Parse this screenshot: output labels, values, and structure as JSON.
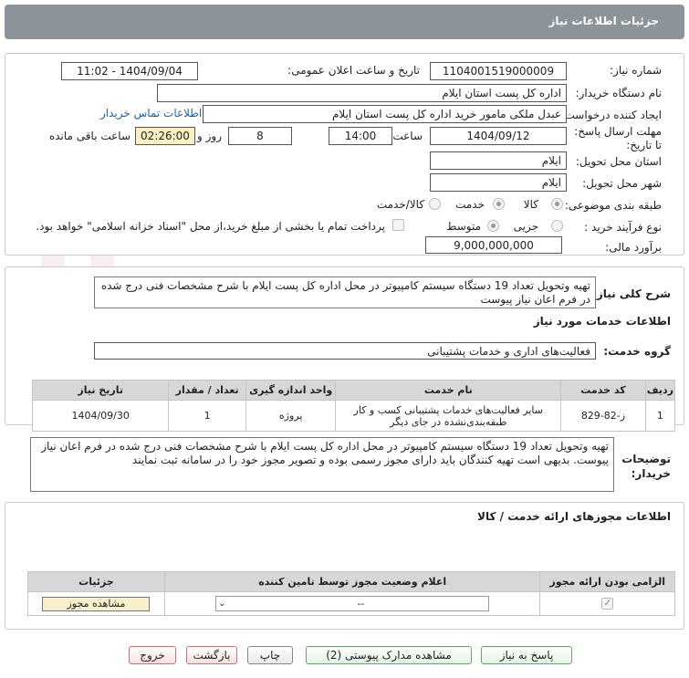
{
  "header": {
    "title": "جزئیات اطلاعات نیاز"
  },
  "form": {
    "need_number_label": "شماره نیاز:",
    "need_number": "1104001519000009",
    "announce_label": "تاریخ و ساعت اعلان عمومی:",
    "announce_value": "1404/09/04 - 11:02",
    "buyer_org_label": "نام دستگاه خریدار:",
    "buyer_org": "اداره کل پست استان ایلام",
    "creator_label": "ایجاد کننده درخواست:",
    "creator": "عبدل ملکی مامور خرید  اداره کل پست استان ایلام",
    "contact_link": "اطلاعات تماس خریدار",
    "deadline_label": "مهلت ارسال پاسخ: تا تاریخ:",
    "deadline_date": "1404/09/12",
    "time_label": "ساعت",
    "deadline_time": "14:00",
    "days": "8",
    "days_label": "روز و",
    "remaining": "02:26:00",
    "remaining_label": "ساعت باقی مانده",
    "province_label": "استان محل تحویل:",
    "province": "ایلام",
    "city_label": "شهر محل تحویل:",
    "city": "ایلام",
    "category_label": "طبقه بندی موضوعی:",
    "category_options": [
      "کالا",
      "خدمت",
      "کالا/خدمت"
    ],
    "process_label": "نوع فرآیند خرید :",
    "process_options": [
      "جزیی",
      "متوسط"
    ],
    "payment_note": "پرداخت تمام یا بخشی از مبلغ خرید،از محل \"اسناد خزانه اسلامی\" خواهد بود.",
    "budget_label": "برآورد مالی:",
    "budget": "9,000,000,000"
  },
  "summary": {
    "label": "شرح کلی نیاز:",
    "text": "تهیه وتحویل تعداد 19 دستگاه سیستم کامپیوتر  در محل  اداره کل پست ایلام با شرح مشخصات فنی درج شده در فرم اعان نیاز پیوست",
    "services_title": "اطلاعات خدمات مورد نیاز",
    "group_label": "گروه خدمت:",
    "group_value": "فعالیت‌های اداری و خدمات پشتیبانی"
  },
  "services_table": {
    "headers": [
      "ردیف",
      "کد خدمت",
      "نام خدمت",
      "واحد اندازه گیری",
      "تعداد / مقدار",
      "تاریخ نیاز"
    ],
    "rows": [
      [
        "1",
        "ز-82-829",
        "سایر فعالیت‌های خدمات پشتیبانی کسب و کار طبقه‌بندی‌نشده در جای دیگر",
        "پروژه",
        "1",
        "1404/09/30"
      ]
    ]
  },
  "buyer_notes": {
    "label": "توضیحات خریدار:",
    "text": "تهیه وتحویل تعداد 19 دستگاه سیستم کامپیوتر  در محل  اداره کل پست ایلام با شرح مشخصات فنی درج شده در فرم اعان نیاز پیوست. بدیهی است تهیه کنندگان باید دارای مجوز رسمی بوده و تصویر مجوز خود را در سامانه ثبت نمایند"
  },
  "permits": {
    "title": "اطلاعات مجوزهای ارائه خدمت / کالا",
    "headers": [
      "الزامی بودن ارائه مجوز",
      "اعلام وضعیت مجوز توسط تامین کننده",
      "جزئیات"
    ],
    "select_value": "--",
    "view_button": "مشاهده مجوز"
  },
  "buttons": {
    "reply": "پاسخ به نیاز",
    "docs": "مشاهده مدارک پیوستی (2)",
    "print": "چاپ",
    "back": "بازگشت",
    "exit": "خروج"
  }
}
